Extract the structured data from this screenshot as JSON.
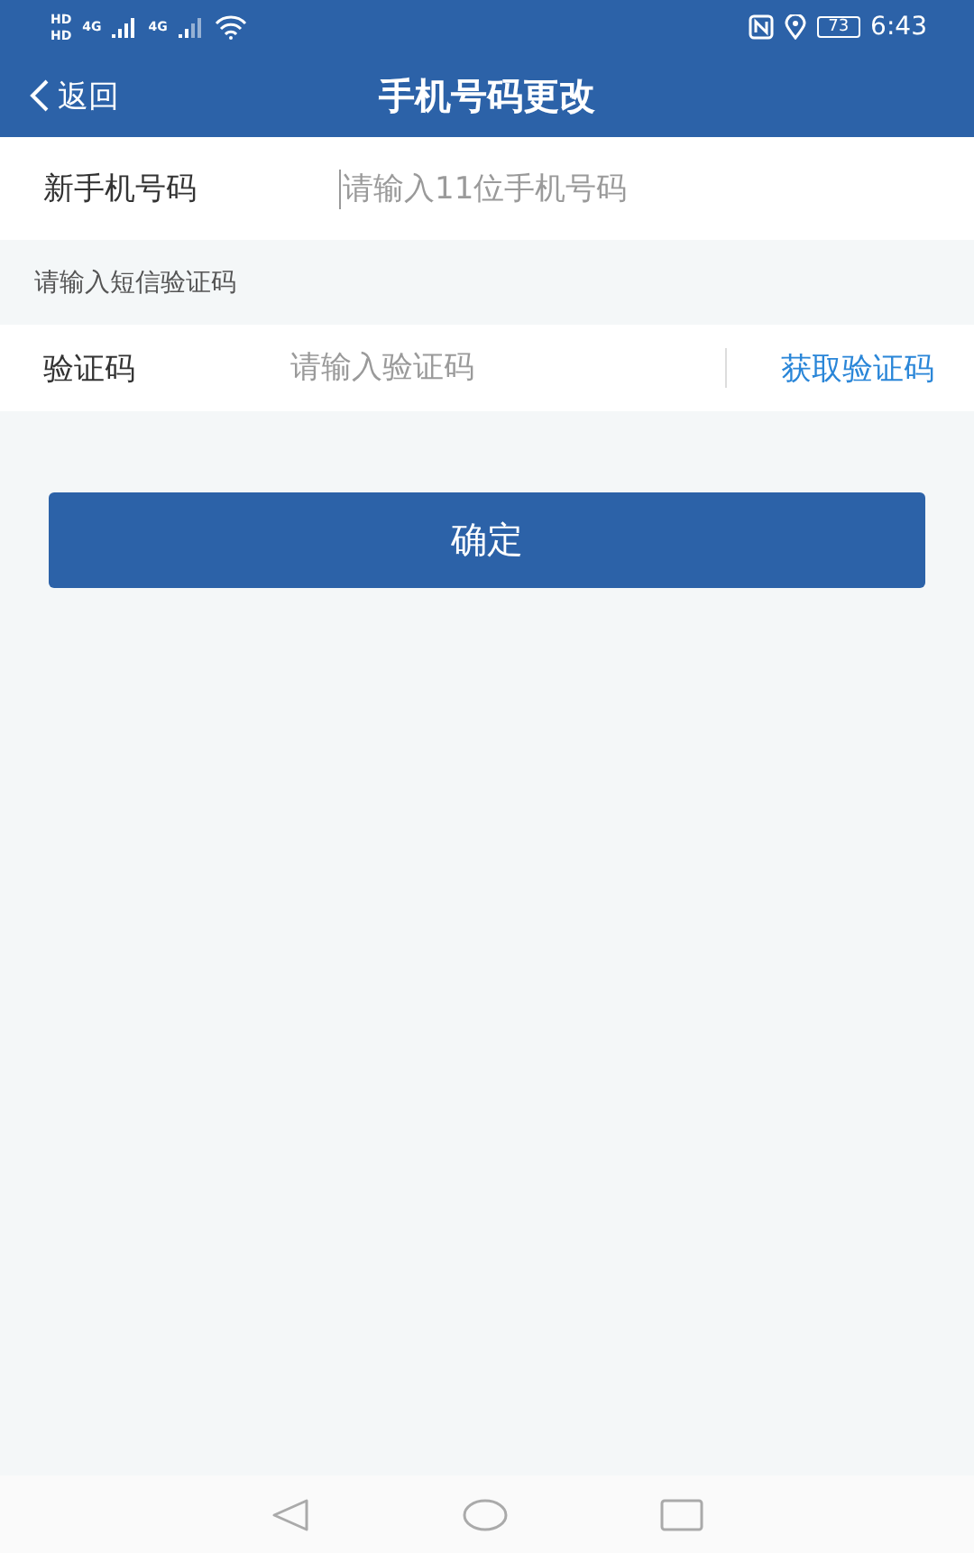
{
  "status_bar": {
    "sims": [
      "HD",
      "HD"
    ],
    "networks": [
      "4G",
      "4G"
    ],
    "battery": "73",
    "time": "6:43"
  },
  "nav_bar": {
    "back": "返回",
    "title": "手机号码更改"
  },
  "phone_field": {
    "label": "新手机号码",
    "placeholder": "请输入11位手机号码"
  },
  "sms_hint": "请输入短信验证码",
  "code_field": {
    "label": "验证码",
    "placeholder": "请输入验证码",
    "action": "获取验证码"
  },
  "submit": "确定"
}
